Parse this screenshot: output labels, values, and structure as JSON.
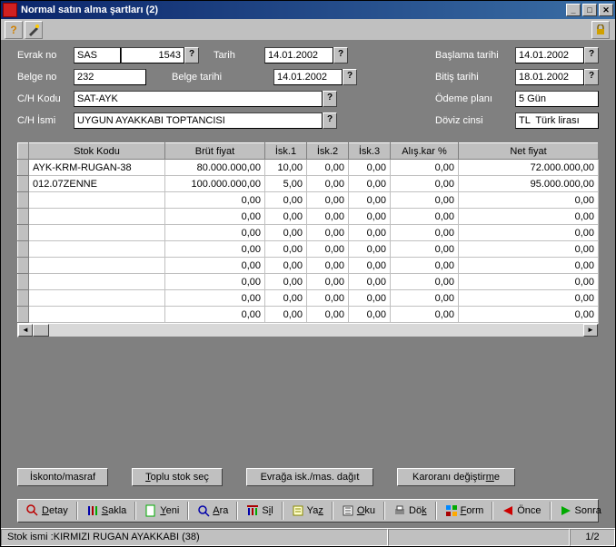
{
  "window": {
    "title": "Normal satın alma şartları (2)"
  },
  "form": {
    "evrak_no_lbl": "Evrak no",
    "evrak_prefix": "SAS",
    "evrak_num": "1543",
    "tarih_lbl": "Tarih",
    "tarih": "14.01.2002",
    "baslama_lbl": "Başlama tarihi",
    "baslama": "14.01.2002",
    "belge_no_lbl": "Belge no",
    "belge_no": "232",
    "belge_tarih_lbl": "Belge tarihi",
    "belge_tarih": "14.01.2002",
    "bitis_lbl": "Bitiş tarihi",
    "bitis": "18.01.2002",
    "ch_kodu_lbl": "C/H Kodu",
    "ch_kodu": "SAT-AYK",
    "odeme_lbl": "Ödeme planı",
    "odeme": "5 Gün",
    "ch_ismi_lbl": "C/H İsmi",
    "ch_ismi": "UYGUN AYAKKABI TOPTANCISI",
    "doviz_lbl": "Döviz cinsi",
    "doviz": "TL  Türk lirası"
  },
  "grid": {
    "headers": [
      "Stok Kodu",
      "Brüt fiyat",
      "İsk.1",
      "İsk.2",
      "İsk.3",
      "Alış.kar %",
      "Net fiyat"
    ],
    "rows": [
      {
        "kod": "AYK-KRM-RUGAN-38",
        "brut": "80.000.000,00",
        "i1": "10,00",
        "i2": "0,00",
        "i3": "0,00",
        "kar": "0,00",
        "net": "72.000.000,00"
      },
      {
        "kod": "012.07ZENNE",
        "brut": "100.000.000,00",
        "i1": "5,00",
        "i2": "0,00",
        "i3": "0,00",
        "kar": "0,00",
        "net": "95.000.000,00"
      },
      {
        "kod": "",
        "brut": "0,00",
        "i1": "0,00",
        "i2": "0,00",
        "i3": "0,00",
        "kar": "0,00",
        "net": "0,00"
      },
      {
        "kod": "",
        "brut": "0,00",
        "i1": "0,00",
        "i2": "0,00",
        "i3": "0,00",
        "kar": "0,00",
        "net": "0,00"
      },
      {
        "kod": "",
        "brut": "0,00",
        "i1": "0,00",
        "i2": "0,00",
        "i3": "0,00",
        "kar": "0,00",
        "net": "0,00"
      },
      {
        "kod": "",
        "brut": "0,00",
        "i1": "0,00",
        "i2": "0,00",
        "i3": "0,00",
        "kar": "0,00",
        "net": "0,00"
      },
      {
        "kod": "",
        "brut": "0,00",
        "i1": "0,00",
        "i2": "0,00",
        "i3": "0,00",
        "kar": "0,00",
        "net": "0,00"
      },
      {
        "kod": "",
        "brut": "0,00",
        "i1": "0,00",
        "i2": "0,00",
        "i3": "0,00",
        "kar": "0,00",
        "net": "0,00"
      },
      {
        "kod": "",
        "brut": "0,00",
        "i1": "0,00",
        "i2": "0,00",
        "i3": "0,00",
        "kar": "0,00",
        "net": "0,00"
      },
      {
        "kod": "",
        "brut": "0,00",
        "i1": "0,00",
        "i2": "0,00",
        "i3": "0,00",
        "kar": "0,00",
        "net": "0,00"
      }
    ]
  },
  "buttons": {
    "isk": "İskonto/masraf",
    "toplu": "Toplu stok seç",
    "evraga": "Evrağa isk./mas. dağıt",
    "karorani": "Karoranı değiştirme"
  },
  "tb": {
    "detay": "Detay",
    "sakla": "Sakla",
    "yeni": "Yeni",
    "ara": "Ara",
    "sil": "Sil",
    "yaz": "Yaz",
    "oku": "Oku",
    "dok": "Dök",
    "form": "Form",
    "once": "Önce",
    "sonra": "Sonra"
  },
  "status": {
    "left": "Stok ismi :KIRMIZI RUGAN AYAKKABI (38)",
    "right": "1/2"
  }
}
